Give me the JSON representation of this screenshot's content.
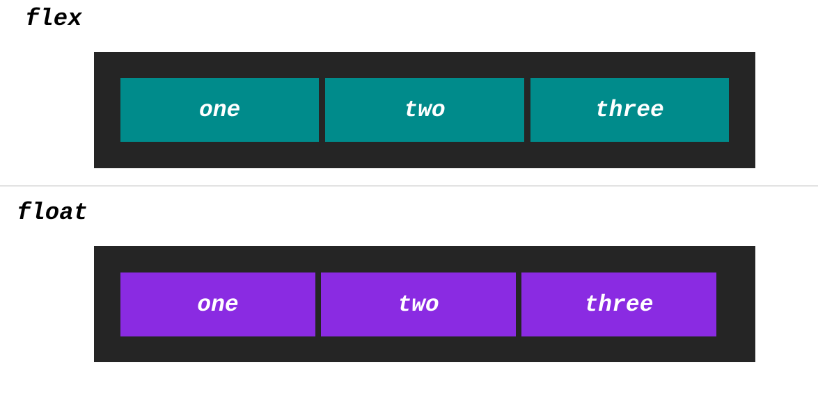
{
  "sections": {
    "flex": {
      "heading": "flex",
      "box_color": "#008B8B",
      "items": [
        {
          "label": "one"
        },
        {
          "label": "two"
        },
        {
          "label": "three"
        }
      ]
    },
    "float": {
      "heading": "float",
      "box_color": "#8A2BE2",
      "items": [
        {
          "label": "one"
        },
        {
          "label": "two"
        },
        {
          "label": "three"
        }
      ]
    }
  },
  "colors": {
    "container_background": "#252525",
    "divider": "#B0B0B0",
    "page_background": "#FFFFFF"
  }
}
